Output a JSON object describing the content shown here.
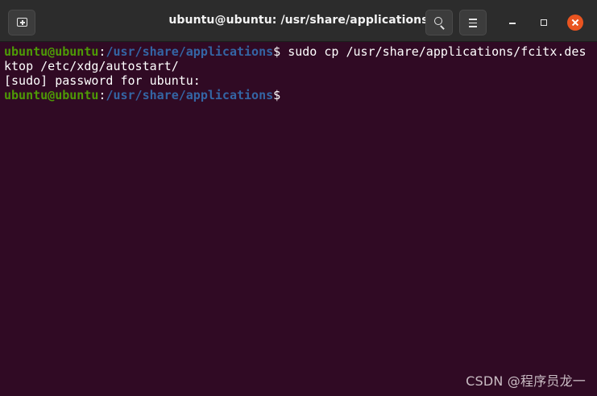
{
  "window": {
    "title": "ubuntu@ubuntu: /usr/share/applications"
  },
  "icons": {
    "new_tab": "new-tab-icon",
    "search": "search-icon",
    "menu": "hamburger-menu-icon",
    "minimize": "minimize-icon",
    "maximize": "maximize-icon",
    "close": "close-icon"
  },
  "colors": {
    "background": "#300a24",
    "user_host": "#4e9a06",
    "path": "#3465a4",
    "close_button": "#e95420"
  },
  "terminal": {
    "line1": {
      "user": "ubuntu@ubuntu",
      "sep": ":",
      "path": "/usr/share/applications",
      "prompt": "$",
      "command": " sudo cp /usr/share/applications/fcitx.des"
    },
    "line2": "ktop /etc/xdg/autostart/",
    "line3": "[sudo] password for ubuntu:",
    "line4": {
      "user": "ubuntu@ubuntu",
      "sep": ":",
      "path": "/usr/share/applications",
      "prompt": "$"
    }
  },
  "watermark": "CSDN @程序员龙一"
}
